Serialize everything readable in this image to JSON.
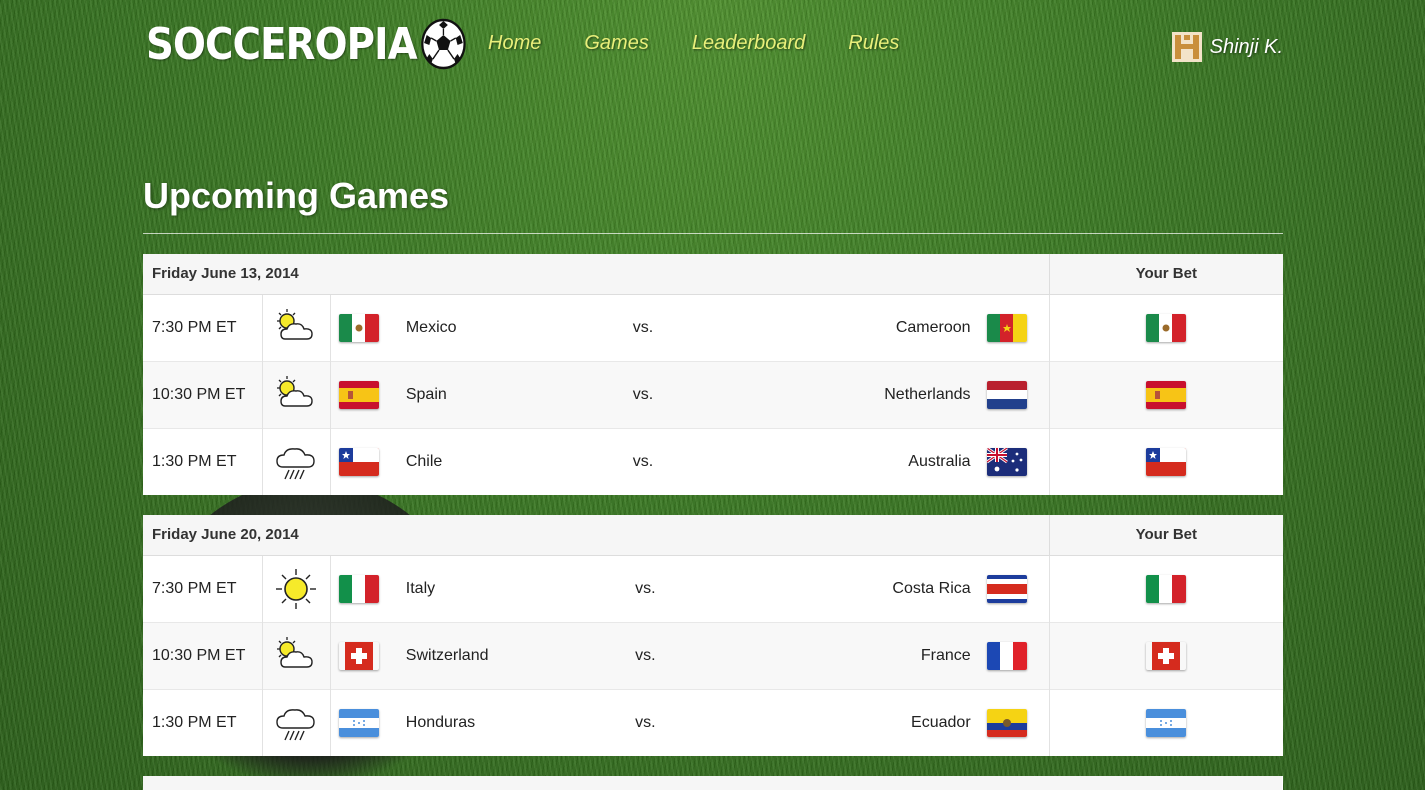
{
  "brand": {
    "name": "SOCCEROPIA"
  },
  "nav": {
    "items": [
      "Home",
      "Games",
      "Leaderboard",
      "Rules"
    ]
  },
  "user": {
    "name": "Shinji K."
  },
  "page": {
    "title": "Upcoming Games"
  },
  "days": [
    {
      "date": "Friday June 13, 2014",
      "bet_header": "Your Bet",
      "games": [
        {
          "time": "7:30 PM ET",
          "weather": "partly-cloudy",
          "team1": "Mexico",
          "team1_flag": "mexico",
          "vs": "vs.",
          "team2": "Cameroon",
          "team2_flag": "cameroon",
          "bet_flag": "mexico"
        },
        {
          "time": "10:30 PM ET",
          "weather": "partly-cloudy",
          "team1": "Spain",
          "team1_flag": "spain",
          "vs": "vs.",
          "team2": "Netherlands",
          "team2_flag": "netherlands",
          "bet_flag": "spain"
        },
        {
          "time": "1:30 PM ET",
          "weather": "rain",
          "team1": "Chile",
          "team1_flag": "chile",
          "vs": "vs.",
          "team2": "Australia",
          "team2_flag": "australia",
          "bet_flag": "chile"
        }
      ]
    },
    {
      "date": "Friday June 20, 2014",
      "bet_header": "Your Bet",
      "games": [
        {
          "time": "7:30 PM ET",
          "weather": "sunny",
          "team1": "Italy",
          "team1_flag": "italy",
          "vs": "vs.",
          "team2": "Costa Rica",
          "team2_flag": "costa-rica",
          "bet_flag": "italy"
        },
        {
          "time": "10:30 PM ET",
          "weather": "partly-cloudy",
          "team1": "Switzerland",
          "team1_flag": "switzerland",
          "vs": "vs.",
          "team2": "France",
          "team2_flag": "france",
          "bet_flag": "switzerland"
        },
        {
          "time": "1:30 PM ET",
          "weather": "rain",
          "team1": "Honduras",
          "team1_flag": "honduras",
          "vs": "vs.",
          "team2": "Ecuador",
          "team2_flag": "ecuador",
          "bet_flag": "honduras"
        }
      ]
    }
  ],
  "colors": {
    "nav_link": "#e9ef7a",
    "grass": "#3a7a22"
  }
}
